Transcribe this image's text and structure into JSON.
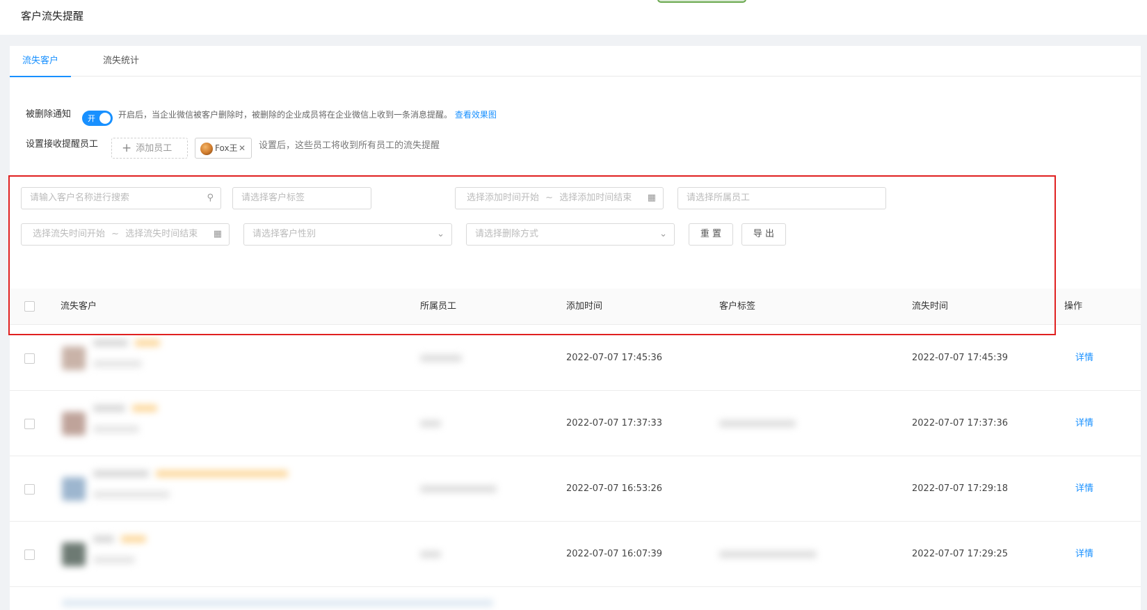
{
  "header": {
    "title": "客户流失提醒"
  },
  "tabs": [
    {
      "label": "流失客户",
      "active": true
    },
    {
      "label": "流失统计",
      "active": false
    }
  ],
  "delete_notice": {
    "label": "被删除通知",
    "switch_text": "开",
    "switch_on": true,
    "hint": "开启后，当企业微信被客户删除时，被删除的企业成员将在企业微信上收到一条消息提醒。",
    "link": "查看效果图"
  },
  "receivers": {
    "label": "设置接收提醒员工",
    "add_button": "添加员工",
    "tag_name": "Fox王",
    "hint": "设置后，这些员工将收到所有员工的流失提醒"
  },
  "filters": {
    "search_placeholder": "请输入客户名称进行搜索",
    "tag_placeholder": "请选择客户标签",
    "add_time_start": "选择添加时间开始",
    "add_time_end": "选择添加时间结束",
    "employee_placeholder": "请选择所属员工",
    "lost_time_start": "选择流失时间开始",
    "lost_time_end": "选择流失时间结束",
    "gender_placeholder": "请选择客户性别",
    "delete_mode_placeholder": "请选择删除方式",
    "range_sep": "~",
    "reset_button": "重 置",
    "export_button": "导 出"
  },
  "table": {
    "columns": [
      "流失客户",
      "所属员工",
      "添加时间",
      "客户标签",
      "流失时间",
      "操作"
    ],
    "rows": [
      {
        "add_time": "2022-07-07 17:45:36",
        "lost_time": "2022-07-07 17:45:39",
        "action": "详情",
        "has_tags": false
      },
      {
        "add_time": "2022-07-07 17:37:33",
        "lost_time": "2022-07-07 17:37:36",
        "action": "详情",
        "has_tags": true
      },
      {
        "add_time": "2022-07-07 16:53:26",
        "lost_time": "2022-07-07 17:29:18",
        "action": "详情",
        "has_tags": false
      },
      {
        "add_time": "2022-07-07 16:07:39",
        "lost_time": "2022-07-07 17:29:25",
        "action": "详情",
        "has_tags": true
      }
    ]
  },
  "colors": {
    "primary": "#1890ff",
    "highlight_box": "#e02020"
  },
  "icons": {
    "search": "search-icon",
    "calendar": "calendar-icon",
    "dropdown": "chevron-down-icon",
    "plus": "plus-icon",
    "close": "close-icon"
  }
}
